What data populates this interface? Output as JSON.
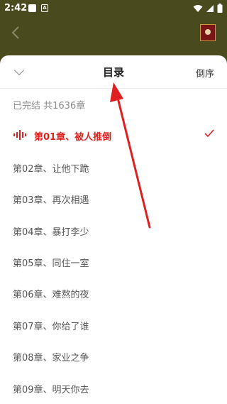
{
  "status_bar": {
    "time": "2:42",
    "notification_letter": "A"
  },
  "sheet": {
    "title": "目录",
    "reverse_label": "倒序",
    "status_text": "已完结 共1636章"
  },
  "chapters": [
    {
      "label": "第01章、被人推倒",
      "current": true
    },
    {
      "label": "第02章、让他下跪",
      "current": false
    },
    {
      "label": "第03章、再次相遇",
      "current": false
    },
    {
      "label": "第04章、暴打李少",
      "current": false
    },
    {
      "label": "第05章、同住一室",
      "current": false
    },
    {
      "label": "第06章、难熬的夜",
      "current": false
    },
    {
      "label": "第07章、你给了谁",
      "current": false
    },
    {
      "label": "第08章、家业之争",
      "current": false
    },
    {
      "label": "第09章、明天你去",
      "current": false
    }
  ],
  "colors": {
    "accent": "#e0201f",
    "top_background": "#4a4a1f",
    "annotation_arrow": "#e02020"
  }
}
